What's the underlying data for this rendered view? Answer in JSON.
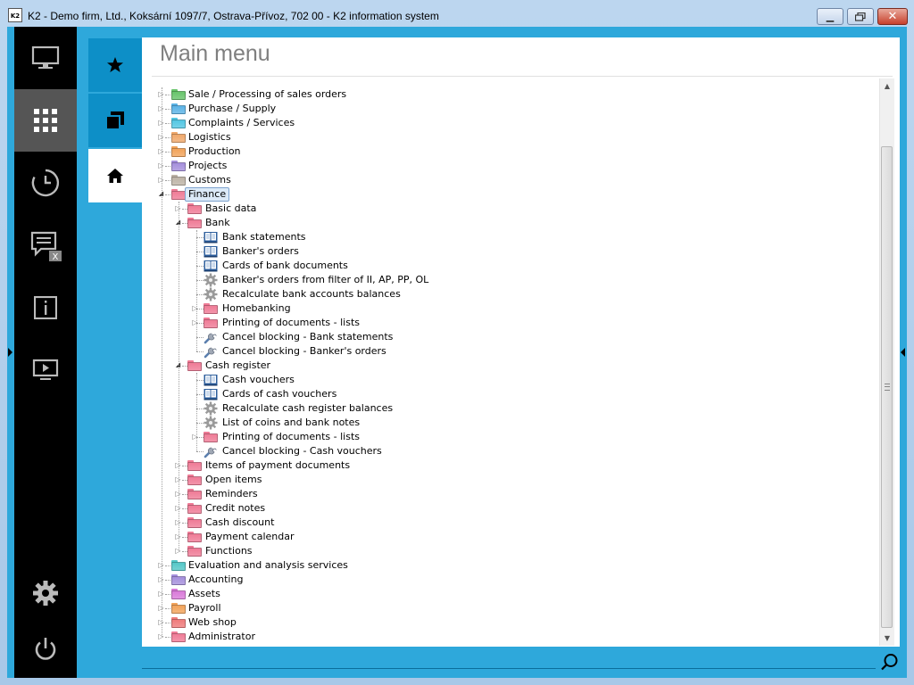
{
  "window": {
    "title": "K2 - Demo firm, Ltd., Koksární 1097/7, Ostrava-Přívoz, 702 00 - K2 information system",
    "app_icon_text": "K2"
  },
  "colors": {
    "accent": "#2ea8db",
    "tab_dark": "#0d8fc7",
    "left_bar": "#000000",
    "left_bar_active": "#555555"
  },
  "left_nav": [
    {
      "icon": "monitor-icon",
      "active": false
    },
    {
      "icon": "apps-grid-icon",
      "active": true
    },
    {
      "icon": "history-clock-icon",
      "active": false
    },
    {
      "icon": "messages-icon",
      "badge": "X",
      "active": false
    },
    {
      "icon": "info-icon",
      "active": false
    },
    {
      "icon": "presentation-icon",
      "active": false
    },
    {
      "icon": "settings-gear-icon",
      "active": false
    },
    {
      "icon": "power-icon",
      "active": false
    }
  ],
  "side_tabs": [
    {
      "icon": "star-icon",
      "active": false
    },
    {
      "icon": "windows-icon",
      "active": false
    },
    {
      "icon": "home-icon",
      "active": true
    }
  ],
  "main": {
    "title": "Main menu"
  },
  "tree": {
    "top": [
      {
        "label": "Sale / Processing of sales orders",
        "color": "#67c46a"
      },
      {
        "label": "Purchase / Supply",
        "color": "#5bb3e6"
      },
      {
        "label": "Complaints / Services",
        "color": "#53c7e3"
      },
      {
        "label": "Logistics",
        "color": "#f0a86b"
      },
      {
        "label": "Production",
        "color": "#f2a35a"
      },
      {
        "label": "Projects",
        "color": "#a58fdc"
      },
      {
        "label": "Customs",
        "color": "#bdb3a6"
      },
      {
        "label": "Finance",
        "color": "#ef7b96",
        "selected": true
      }
    ],
    "finance": {
      "basic_data": "Basic data",
      "bank": "Bank",
      "bank_items": [
        {
          "label": "Bank statements",
          "icon": "book-icon"
        },
        {
          "label": "Banker's orders",
          "icon": "book-icon"
        },
        {
          "label": "Cards of bank documents",
          "icon": "book-icon"
        },
        {
          "label": "Banker's orders from filter of II, AP, PP, OL",
          "icon": "gear-icon"
        },
        {
          "label": "Recalculate bank accounts balances",
          "icon": "gear-icon"
        },
        {
          "label": "Homebanking",
          "icon": "folder-icon",
          "expandable": true
        },
        {
          "label": "Printing of documents - lists",
          "icon": "folder-icon",
          "expandable": true
        },
        {
          "label": "Cancel blocking - Bank statements",
          "icon": "wrench-icon"
        },
        {
          "label": "Cancel blocking - Banker's orders",
          "icon": "wrench-icon"
        }
      ],
      "cash_register": "Cash register",
      "cash_items": [
        {
          "label": "Cash vouchers",
          "icon": "book-icon"
        },
        {
          "label": "Cards of cash vouchers",
          "icon": "book-icon"
        },
        {
          "label": "Recalculate cash register balances",
          "icon": "gear-icon"
        },
        {
          "label": "List of coins and bank notes",
          "icon": "gear-icon"
        },
        {
          "label": "Printing of documents - lists",
          "icon": "folder-icon",
          "expandable": true
        },
        {
          "label": "Cancel blocking - Cash vouchers",
          "icon": "wrench-icon"
        }
      ],
      "other": [
        "Items of payment documents",
        "Open items",
        "Reminders",
        "Credit notes",
        "Cash discount",
        "Payment calendar",
        "Functions"
      ]
    },
    "bottom": [
      {
        "label": "Evaluation and analysis services",
        "color": "#53c7c7"
      },
      {
        "label": "Accounting",
        "color": "#a58fdc"
      },
      {
        "label": "Assets",
        "color": "#d97ad9"
      },
      {
        "label": "Payroll",
        "color": "#f2a35a"
      },
      {
        "label": "Web shop",
        "color": "#ef7b7b"
      },
      {
        "label": "Administrator",
        "color": "#ef7b96"
      }
    ]
  },
  "search": {
    "icon": "search-icon"
  }
}
